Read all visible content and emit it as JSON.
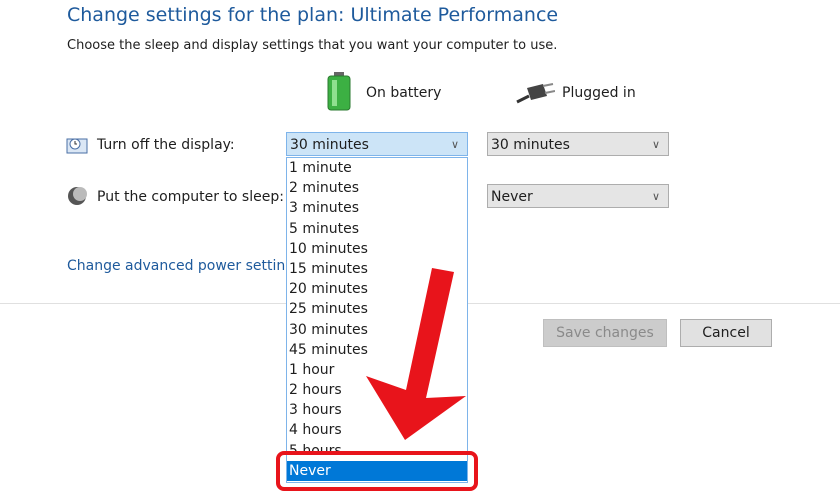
{
  "title": "Change settings for the plan: Ultimate Performance",
  "subtitle": "Choose the sleep and display settings that you want your computer to use.",
  "columns": {
    "battery": "On battery",
    "plugged": "Plugged in"
  },
  "rows": {
    "display": "Turn off the display:",
    "sleep": "Put the computer to sleep:"
  },
  "display_battery": "30 minutes",
  "display_plugged": "30 minutes",
  "sleep_plugged": "Never",
  "options": [
    "1 minute",
    "2 minutes",
    "3 minutes",
    "5 minutes",
    "10 minutes",
    "15 minutes",
    "20 minutes",
    "25 minutes",
    "30 minutes",
    "45 minutes",
    "1 hour",
    "2 hours",
    "3 hours",
    "4 hours",
    "5 hours",
    "Never"
  ],
  "highlighted_option": "Never",
  "advanced_link": "Change advanced power settings",
  "buttons": {
    "save": "Save changes",
    "cancel": "Cancel"
  },
  "colors": {
    "annotation": "#e8141b",
    "selection": "#0078d7",
    "link": "#1e5a9c"
  }
}
